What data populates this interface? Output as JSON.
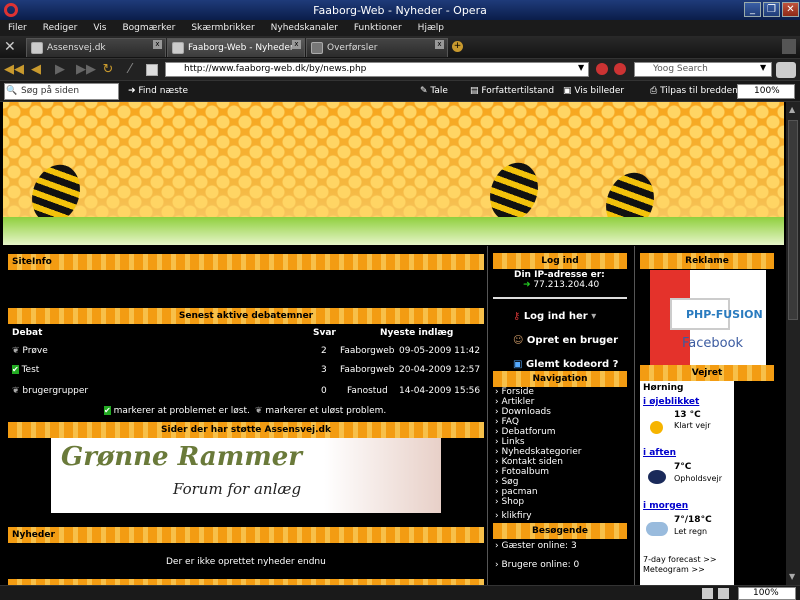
{
  "window": {
    "title": "Faaborg-Web - Nyheder - Opera"
  },
  "menu": [
    "Filer",
    "Rediger",
    "Vis",
    "Bogmærker",
    "Skærmbrikker",
    "Nyhedskanaler",
    "Funktioner",
    "Hjælp"
  ],
  "tabs": [
    {
      "label": "Assensvej.dk"
    },
    {
      "label": "Faaborg-Web - Nyheder"
    },
    {
      "label": "Overførsler"
    }
  ],
  "address": {
    "url": "http://www.faaborg-web.dk/by/news.php"
  },
  "search": {
    "engine": "Yoog Search"
  },
  "findbar": {
    "placeholder": "Søg på siden",
    "find_next": "Find næste",
    "speak": "Tale",
    "author_mode": "Forfattertilstand",
    "show_images": "Vis billeder",
    "fit_width": "Tilpas til bredden",
    "zoom": "100%"
  },
  "siteinfo": {
    "title": "SiteInfo"
  },
  "debates": {
    "title": "Senest aktive debatemner",
    "headers": {
      "topic": "Debat",
      "replies": "Svar",
      "latest": "Nyeste indlæg"
    },
    "rows": [
      {
        "topic": "Prøve",
        "replies": "2",
        "user": "Faaborgweb",
        "date": "09-05-2009 11:42"
      },
      {
        "topic": "Test",
        "replies": "3",
        "user": "Faaborgweb",
        "date": "20-04-2009 12:57"
      },
      {
        "topic": "brugergrupper",
        "replies": "0",
        "user": "Fanostud",
        "date": "14-04-2009 15:56"
      }
    ],
    "legend_solved": "markerer at problemet er løst.",
    "legend_unsolved": "markerer et uløst problem."
  },
  "support": {
    "title": "Sider der har støtte Assensvej.dk",
    "banner_line1": "Grønne Rammer",
    "banner_line2": "Forum for anlæg"
  },
  "news": {
    "title": "Nyheder",
    "empty": "Der er ikke oprettet nyheder endnu"
  },
  "login": {
    "title": "Log ind",
    "ip_label": "Din IP-adresse er:",
    "ip": "77.213.204.40",
    "login_here": "Log ind her",
    "register": "Opret en bruger",
    "forgot": "Glemt kodeord ?"
  },
  "navigation": {
    "title": "Navigation",
    "items": [
      "Forside",
      "Artikler",
      "Downloads",
      "FAQ",
      "Debatforum",
      "Links",
      "Nyhedskategorier",
      "Kontakt siden",
      "Fotoalbum",
      "Søg",
      "pacman",
      "Shop",
      "klikfiry"
    ]
  },
  "visitors": {
    "title": "Besøgende",
    "guests": "Gæster online: 3",
    "users": "Brugere online: 0"
  },
  "ad": {
    "title": "Reklame",
    "logo": "PHP-FUSION",
    "brand": "Facebook"
  },
  "weather": {
    "title": "Vejret",
    "city": "Hørning",
    "now_label": "i øjeblikket",
    "now_temp": "13 °C",
    "now_desc": "Klart vejr",
    "eve_label": "i aften",
    "eve_temp": "7°C",
    "eve_desc": "Opholdsvejr",
    "morn_label": "i morgen",
    "morn_temp": "7°/18°C",
    "morn_desc": "Let regn",
    "forecast": "7-day forecast >>",
    "meteogram": "Meteogram >>"
  },
  "status": {
    "zoom": "100%"
  }
}
